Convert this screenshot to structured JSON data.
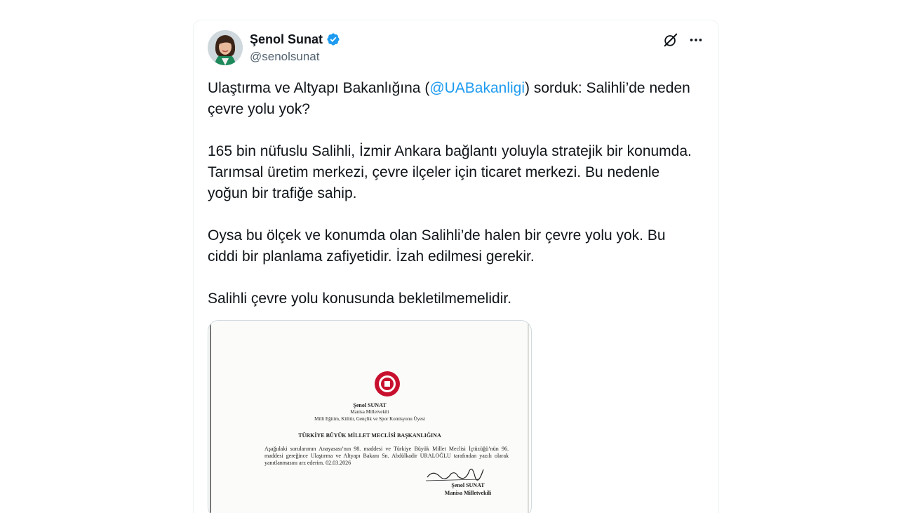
{
  "author": {
    "display_name": "Şenol Sunat",
    "handle": "@senolsunat"
  },
  "tweet": {
    "p1_before": "Ulaştırma ve Altyapı Bakanlığına (",
    "p1_mention": "@UABakanligi",
    "p1_after": ") sorduk: Salihli’de neden çevre yolu yok?",
    "p2": "165 bin nüfuslu Salihli, İzmir Ankara bağlantı yoluyla stratejik bir konumda. Tarımsal üretim merkezi, çevre ilçeler için ticaret merkezi. Bu nedenle yoğun bir trafiğe sahip.",
    "p3": "Oysa bu ölçek ve konumda olan Salihli’de halen bir çevre yolu yok. Bu ciddi bir planlama zafiyetidir. İzah edilmesi gerekir.",
    "p4": "Salihli çevre yolu konusunda bekletilmemelidir."
  },
  "document": {
    "name": "Şenol SUNAT",
    "role": "Manisa Milletvekili",
    "committee": "Milli Eğitim, Kültür, Gençlik ve Spor Komisyonu Üyesi",
    "heading": "TÜRKİYE BÜYÜK MİLLET MECLİSİ BAŞKANLIĞINA",
    "body": "Aşağıdaki sorularımın Anayasası’nın 98. maddesi ve Türkiye Büyük Millet Meclisi İçtüzüğü’nün 96. maddesi gereğince Ulaştırma ve Altyapı Bakanı Sn. Abdülkadir URALOĞLU tarafından yazılı olarak yanıtlanmasını arz ederim. 02.03.2026",
    "sign_name": "Şenol SUNAT",
    "sign_role": "Manisa Milletvekili"
  },
  "icons": {
    "verified": "verified-badge-icon",
    "grok": "grok-icon",
    "more": "more-icon"
  },
  "colors": {
    "accent": "#1d9bf0",
    "text": "#0f1419",
    "secondary": "#536471"
  }
}
